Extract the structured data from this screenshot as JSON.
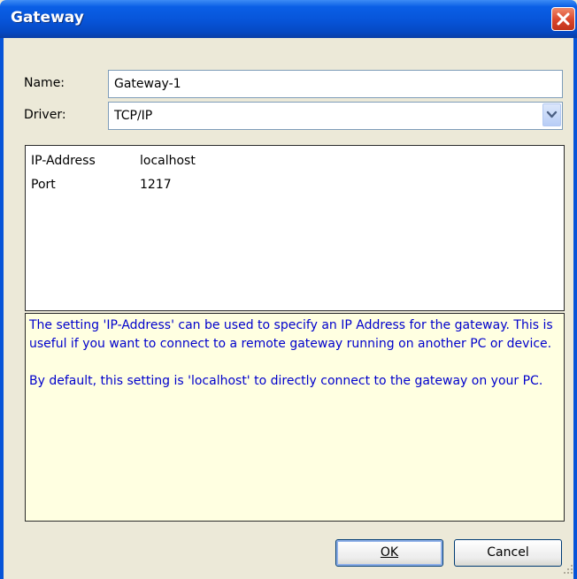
{
  "window": {
    "title": "Gateway"
  },
  "form": {
    "name_label": "Name:",
    "name_value": "Gateway-1",
    "driver_label": "Driver:",
    "driver_value": "TCP/IP"
  },
  "properties": [
    {
      "name": "IP-Address",
      "value": "localhost"
    },
    {
      "name": "Port",
      "value": "1217"
    }
  ],
  "description": {
    "paragraph1": "The setting 'IP-Address' can be used to specify an IP Address for the gateway. This is useful if you want to connect to a remote gateway running on another PC or device.",
    "paragraph2": "By default, this setting is 'localhost' to directly connect to the gateway on your PC."
  },
  "buttons": {
    "ok_label": "OK",
    "cancel_label": "Cancel"
  },
  "colors": {
    "titlebar": "#0754d8",
    "description_bg": "#ffffe1",
    "description_text": "#0000cc",
    "close_button": "#d9452b"
  }
}
